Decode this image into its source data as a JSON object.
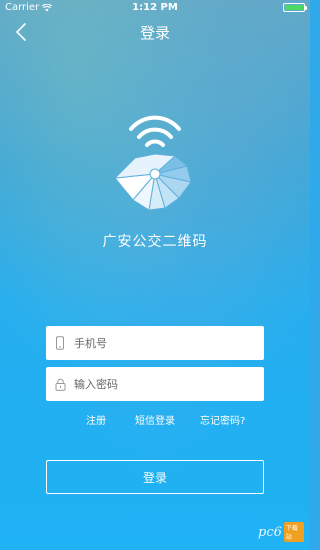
{
  "status_bar": {
    "carrier": "Carrier",
    "time": "1:12 PM",
    "battery_level": 1.0
  },
  "nav": {
    "title": "登录",
    "back_icon": "chevron-left-icon"
  },
  "app": {
    "name": "广安公交二维码",
    "logo_icon": "scanner-wifi-logo"
  },
  "form": {
    "phone": {
      "placeholder": "手机号",
      "value": "",
      "icon": "phone-icon"
    },
    "password": {
      "placeholder": "输入密码",
      "value": "",
      "icon": "lock-icon"
    }
  },
  "links": {
    "register": "注册",
    "sms_login": "短信登录",
    "forgot_password": "忘记密码?"
  },
  "login_button": "登录",
  "watermark": {
    "text": "pc6",
    "badge": "下载站"
  },
  "colors": {
    "background": "#2fa9ea",
    "text": "#ffffff",
    "battery": "#4cd964"
  }
}
